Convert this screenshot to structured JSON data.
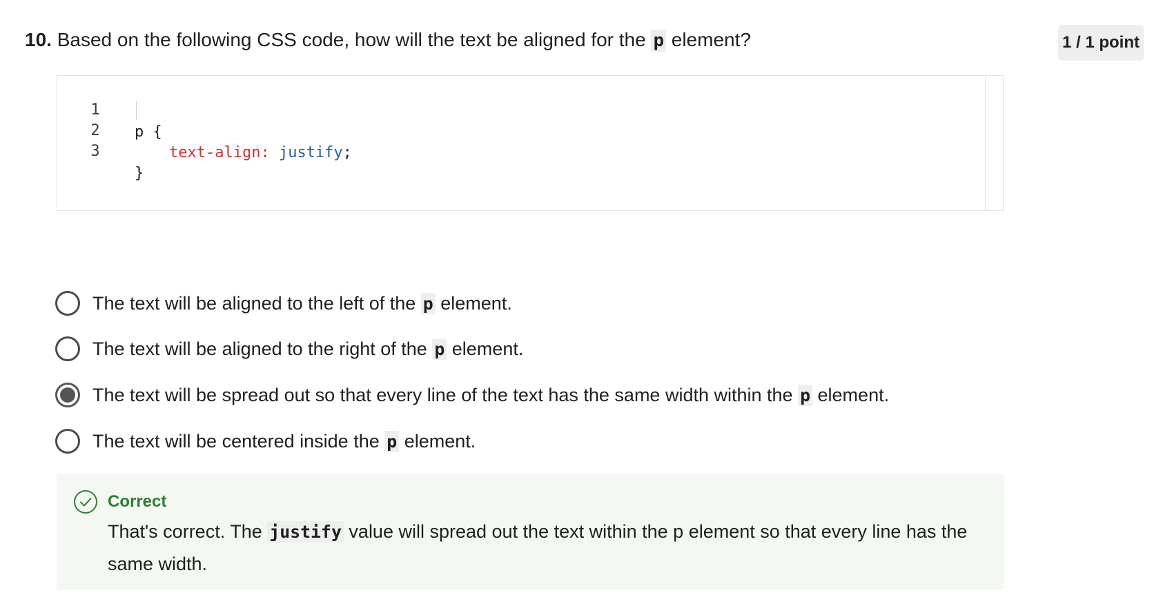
{
  "question": {
    "number": "10.",
    "text_before": "Based on the following CSS code, how will the text be aligned for the",
    "code": "p",
    "text_after": "element?"
  },
  "points": "1 / 1 point",
  "code_editor": {
    "lines": [
      {
        "number": "1",
        "text": "p {"
      },
      {
        "number": "2",
        "property": "text-align:",
        "value": "justify",
        "punct": ";"
      },
      {
        "number": "3",
        "text": "}"
      }
    ]
  },
  "options": [
    {
      "before": "The text will be aligned to the left of the",
      "code": "p",
      "after": "element.",
      "selected": false
    },
    {
      "before": "The text will be aligned to the right of the",
      "code": "p",
      "after": "element.",
      "selected": false
    },
    {
      "before": "The text will be spread out so that every line of the text has the same width within the",
      "code": "p",
      "after": "element.",
      "selected": true
    },
    {
      "before": "The text will be centered inside the",
      "code": "p",
      "after": "element.",
      "selected": false
    }
  ],
  "feedback": {
    "status": "Correct",
    "text_before": "That's correct. The",
    "code": "justify",
    "text_after": "value will spread out the text within the p element so that every line has the same width."
  },
  "colors": {
    "correct_green": "#2e7d32",
    "feedback_bg": "#f3f8f3",
    "css_property": "#d32f2f",
    "css_value": "#1f5fa8"
  }
}
